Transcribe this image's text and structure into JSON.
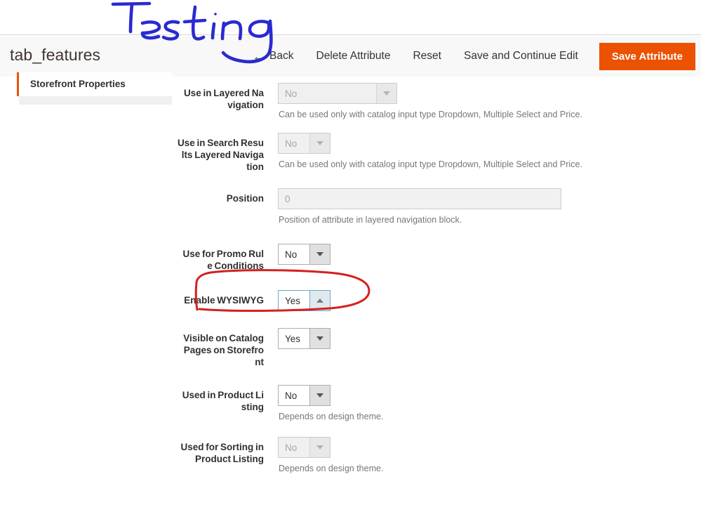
{
  "header": {
    "title": "tab_features",
    "back_label": "Back",
    "back_icon": "arrow-left-icon",
    "delete_label": "Delete Attribute",
    "reset_label": "Reset",
    "save_continue_label": "Save and Continue Edit",
    "save_label": "Save Attribute",
    "primary_color": "#eb5202",
    "background": "#f8f8f8"
  },
  "sidebar": {
    "items": [
      {
        "label": "Storefront Properties",
        "active": true,
        "accent": "#eb5202"
      }
    ]
  },
  "form": {
    "fields": [
      {
        "label_lines": [
          "Use in Layered Na",
          "vigation"
        ],
        "control": "select",
        "value": "No",
        "state": "disabled",
        "width": "wide",
        "arrow": "chevron-down-icon",
        "hint": "Can be used only with catalog input type Dropdown, Multiple Select and Price."
      },
      {
        "label_lines": [
          "Use in Search Resu",
          "lts Layered Naviga",
          "tion"
        ],
        "control": "select",
        "value": "No",
        "state": "disabled",
        "width": "narrow",
        "arrow": "chevron-down-icon",
        "hint": "Can be used only with catalog input type Dropdown, Multiple Select and Price."
      },
      {
        "label_lines": [
          "Position"
        ],
        "control": "text",
        "value": "0",
        "state": "disabled",
        "hint": "Position of attribute in layered navigation block."
      },
      {
        "label_lines": [
          "Use for Promo Rul",
          "e Conditions"
        ],
        "control": "select",
        "value": "No",
        "state": "enabled",
        "width": "narrow",
        "arrow": "chevron-down-icon",
        "hint": ""
      },
      {
        "label_lines": [
          "Enable WYSIWYG"
        ],
        "control": "select",
        "value": "Yes",
        "state": "focused",
        "width": "narrow",
        "arrow": "chevron-up-icon",
        "hint": ""
      },
      {
        "label_lines": [
          "Visible on Catalog",
          "Pages on Storefro",
          "nt"
        ],
        "control": "select",
        "value": "Yes",
        "state": "enabled",
        "width": "narrow",
        "arrow": "chevron-down-icon",
        "hint": ""
      },
      {
        "label_lines": [
          "Used in Product Li",
          "sting"
        ],
        "control": "select",
        "value": "No",
        "state": "enabled",
        "width": "narrow",
        "arrow": "chevron-down-icon",
        "hint": "Depends on design theme."
      },
      {
        "label_lines": [
          "Used for Sorting in",
          "Product Listing"
        ],
        "control": "select",
        "value": "No",
        "state": "disabled",
        "width": "narrow",
        "arrow": "chevron-down-icon",
        "hint": "Depends on design theme."
      }
    ]
  },
  "annotations": {
    "handwriting_text": "Testing",
    "handwriting_color": "#2a2ad0",
    "highlight_shape": "ellipse",
    "highlight_color": "#d42020",
    "highlight_target": "Enable WYSIWYG"
  }
}
